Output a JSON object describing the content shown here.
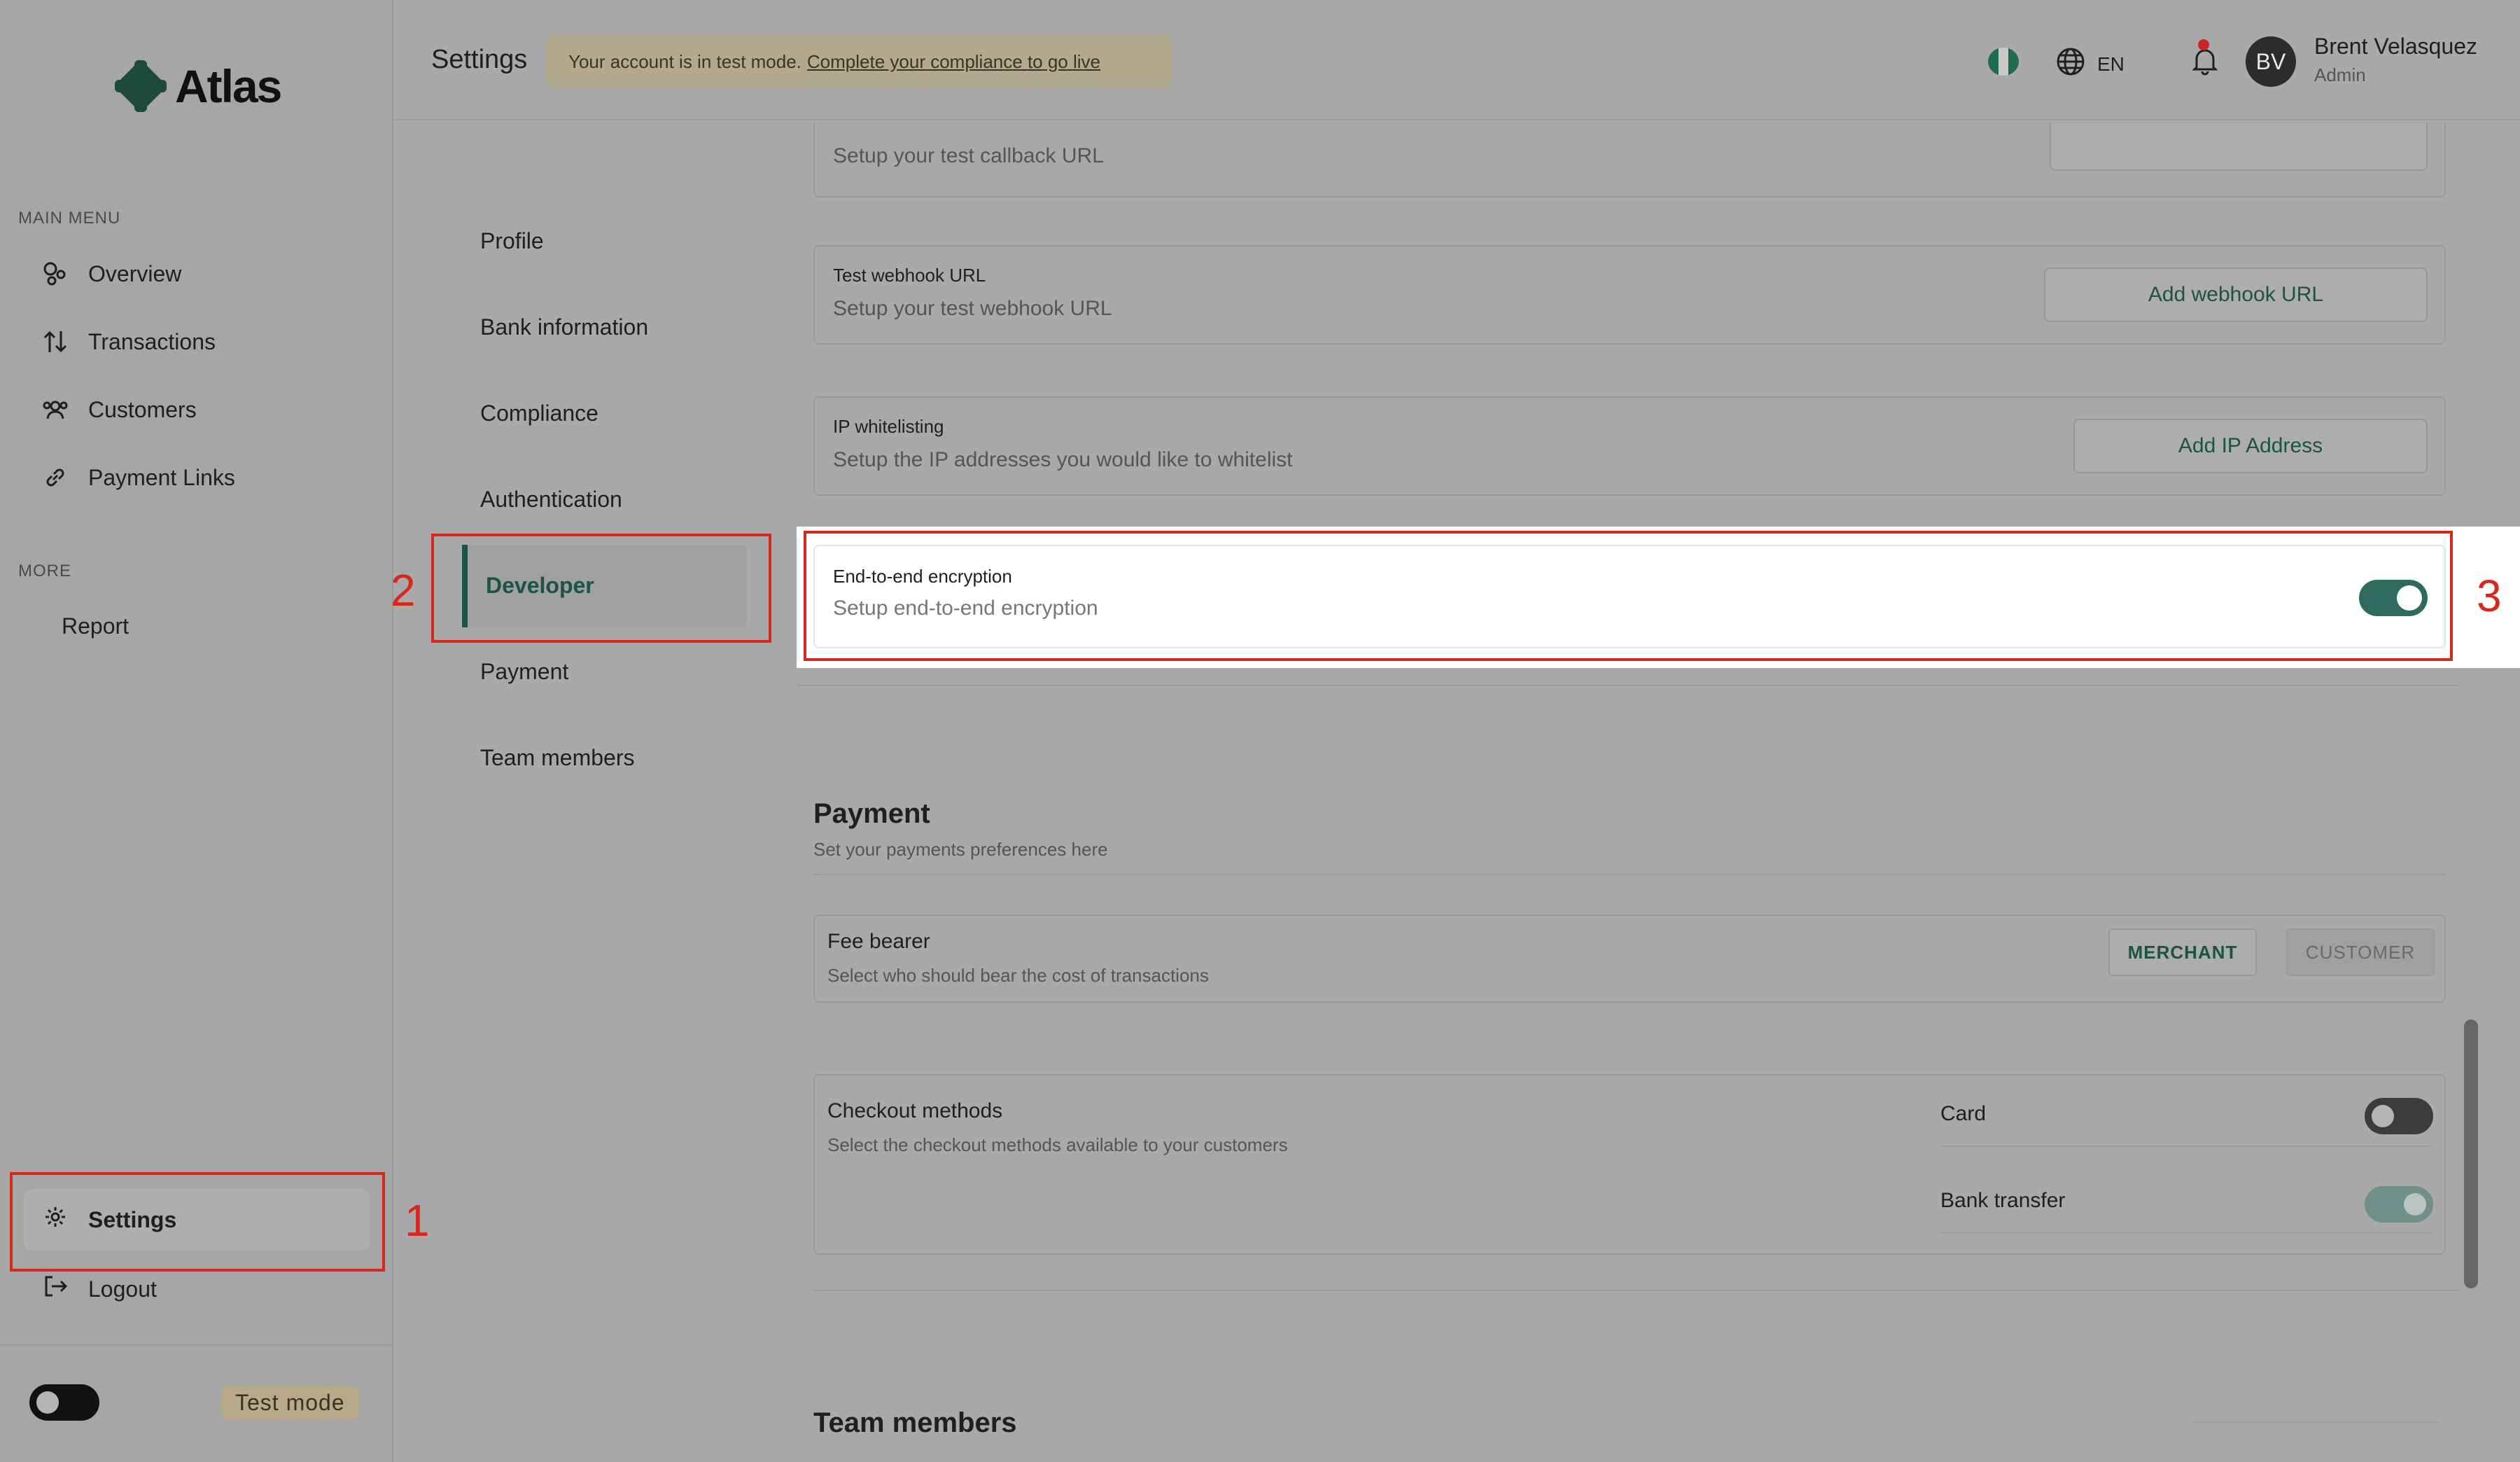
{
  "brand": {
    "name": "Atlas"
  },
  "sidebar": {
    "main_menu_heading": "MAIN MENU",
    "main_menu": [
      {
        "label": "Overview",
        "icon": "overview-icon"
      },
      {
        "label": "Transactions",
        "icon": "transactions-icon"
      },
      {
        "label": "Customers",
        "icon": "customers-icon"
      },
      {
        "label": "Payment Links",
        "icon": "link-icon"
      }
    ],
    "more_heading": "MORE",
    "more_menu": [
      {
        "label": "Report"
      }
    ],
    "settings_label": "Settings",
    "logout_label": "Logout",
    "test_mode_label": "Test mode",
    "test_mode_on": false
  },
  "header": {
    "title": "Settings",
    "banner_text": "Your account is in test mode.",
    "banner_link": "Complete your compliance to go live",
    "language": "EN",
    "notifications_unread": true,
    "user": {
      "initials": "BV",
      "name": "Brent Velasquez",
      "role": "Admin"
    }
  },
  "settings_nav": {
    "items": [
      "Profile",
      "Bank information",
      "Compliance",
      "Authentication",
      "Developer",
      "Payment",
      "Team members"
    ],
    "active": "Developer"
  },
  "developer": {
    "callback_sub": "Setup your test callback URL",
    "webhook": {
      "title": "Test webhook URL",
      "subtitle": "Setup your test webhook URL",
      "button": "Add webhook URL"
    },
    "ip": {
      "title": "IP whitelisting",
      "subtitle": "Setup the IP addresses you would like to whitelist",
      "button": "Add IP Address"
    },
    "encryption": {
      "title": "End-to-end encryption",
      "subtitle": "Setup end-to-end encryption",
      "enabled": true
    }
  },
  "payment": {
    "title": "Payment",
    "subtitle": "Set your payments preferences here",
    "fee_bearer": {
      "title": "Fee bearer",
      "subtitle": "Select who should bear the cost of transactions",
      "options": [
        "MERCHANT",
        "CUSTOMER"
      ],
      "selected": "MERCHANT"
    },
    "checkout": {
      "title": "Checkout methods",
      "subtitle": "Select the checkout methods available to your customers",
      "methods": [
        {
          "label": "Card",
          "enabled": false
        },
        {
          "label": "Bank transfer",
          "enabled": true
        }
      ]
    }
  },
  "team": {
    "title": "Team members"
  },
  "annotations": [
    "1",
    "2",
    "3"
  ],
  "colors": {
    "accent": "#1d5247",
    "toggle_on": "#2e6b5e",
    "annotation": "#d8281c",
    "banner": "#b2a98f"
  }
}
